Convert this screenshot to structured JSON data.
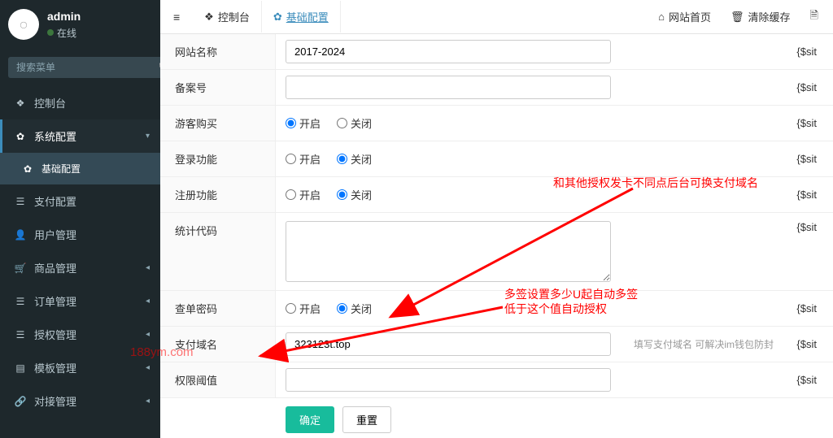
{
  "user": {
    "name": "admin",
    "status": "在线"
  },
  "search": {
    "placeholder": "搜索菜单"
  },
  "menu": {
    "console": "控制台",
    "system": "系统配置",
    "basic": "基础配置",
    "pay": "支付配置",
    "users": "用户管理",
    "goods": "商品管理",
    "orders": "订单管理",
    "auth": "授权管理",
    "tpl": "模板管理",
    "dock": "对接管理"
  },
  "tabs": {
    "console": "控制台",
    "basic": "基础配置"
  },
  "topbar": {
    "home": "网站首页",
    "clear": "清除缓存"
  },
  "form": {
    "site_name_label": "网站名称",
    "site_name_value": "2017-2024",
    "icp_label": "备案号",
    "icp_value": "",
    "guest_buy_label": "游客购买",
    "login_label": "登录功能",
    "register_label": "注册功能",
    "stats_label": "统计代码",
    "stats_value": "",
    "query_pwd_label": "查单密码",
    "pay_domain_label": "支付域名",
    "pay_domain_value": "323123t.top",
    "pay_domain_hint": "填写支付域名 可解决im钱包防封",
    "threshold_label": "权限阈值",
    "threshold_value": "",
    "radio_on": "开启",
    "radio_off": "关闭",
    "var_hint": "{$sit"
  },
  "buttons": {
    "submit": "确定",
    "reset": "重置"
  },
  "annot": {
    "note1": "和其他授权发卡不同点后台可换支付域名",
    "note2a": "多签设置多少U起自动多签",
    "note2b": "低于这个值自动授权",
    "watermark": "188ym.com"
  }
}
